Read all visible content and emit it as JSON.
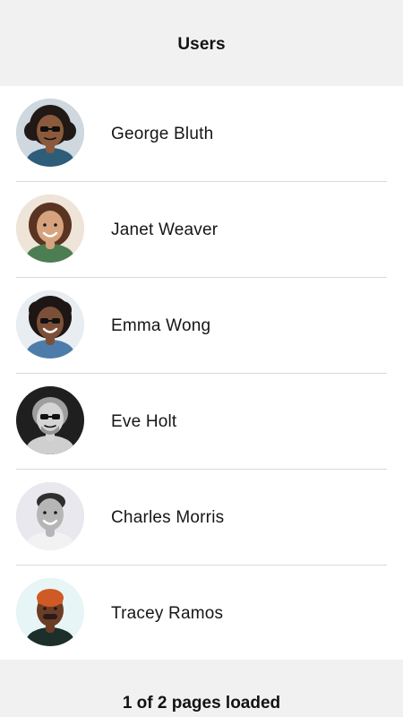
{
  "header": {
    "title": "Users"
  },
  "users": [
    {
      "name": "George Bluth",
      "avatar_icon": "user-avatar-photo",
      "colors": {
        "bg": "#cfd7df",
        "skin": "#8b5a3c",
        "hair": "#201915",
        "shirt": "#2d5d79",
        "accent": "#0f0f0f"
      }
    },
    {
      "name": "Janet Weaver",
      "avatar_icon": "user-avatar-photo",
      "colors": {
        "bg": "#efe4d8",
        "skin": "#d7a37f",
        "hair": "#5a3422",
        "shirt": "#4d7d52",
        "accent": "#b04c47"
      }
    },
    {
      "name": "Emma Wong",
      "avatar_icon": "user-avatar-photo",
      "colors": {
        "bg": "#e8edf1",
        "skin": "#7c5038",
        "hair": "#1d1614",
        "shirt": "#4d7cab",
        "accent": "#111111"
      }
    },
    {
      "name": "Eve Holt",
      "avatar_icon": "user-avatar-photo",
      "colors": {
        "bg": "#1f1f1f",
        "skin": "#d4d4d4",
        "hair": "#9e9e9e",
        "shirt": "#cfcfcf",
        "accent": "#111111"
      }
    },
    {
      "name": "Charles Morris",
      "avatar_icon": "user-avatar-photo",
      "colors": {
        "bg": "#e8e8ee",
        "skin": "#b6b6b6",
        "hair": "#2f2f2f",
        "shirt": "#f2f2f2",
        "accent": "#1b1b1b"
      }
    },
    {
      "name": "Tracey Ramos",
      "avatar_icon": "user-avatar-photo",
      "colors": {
        "bg": "#e7f5f6",
        "skin": "#6c3d25",
        "hair": "#d05a25",
        "shirt": "#1d2f2a",
        "accent": "#2b1b1b"
      }
    }
  ],
  "footer": {
    "status_text": "1 of 2 pages loaded"
  }
}
